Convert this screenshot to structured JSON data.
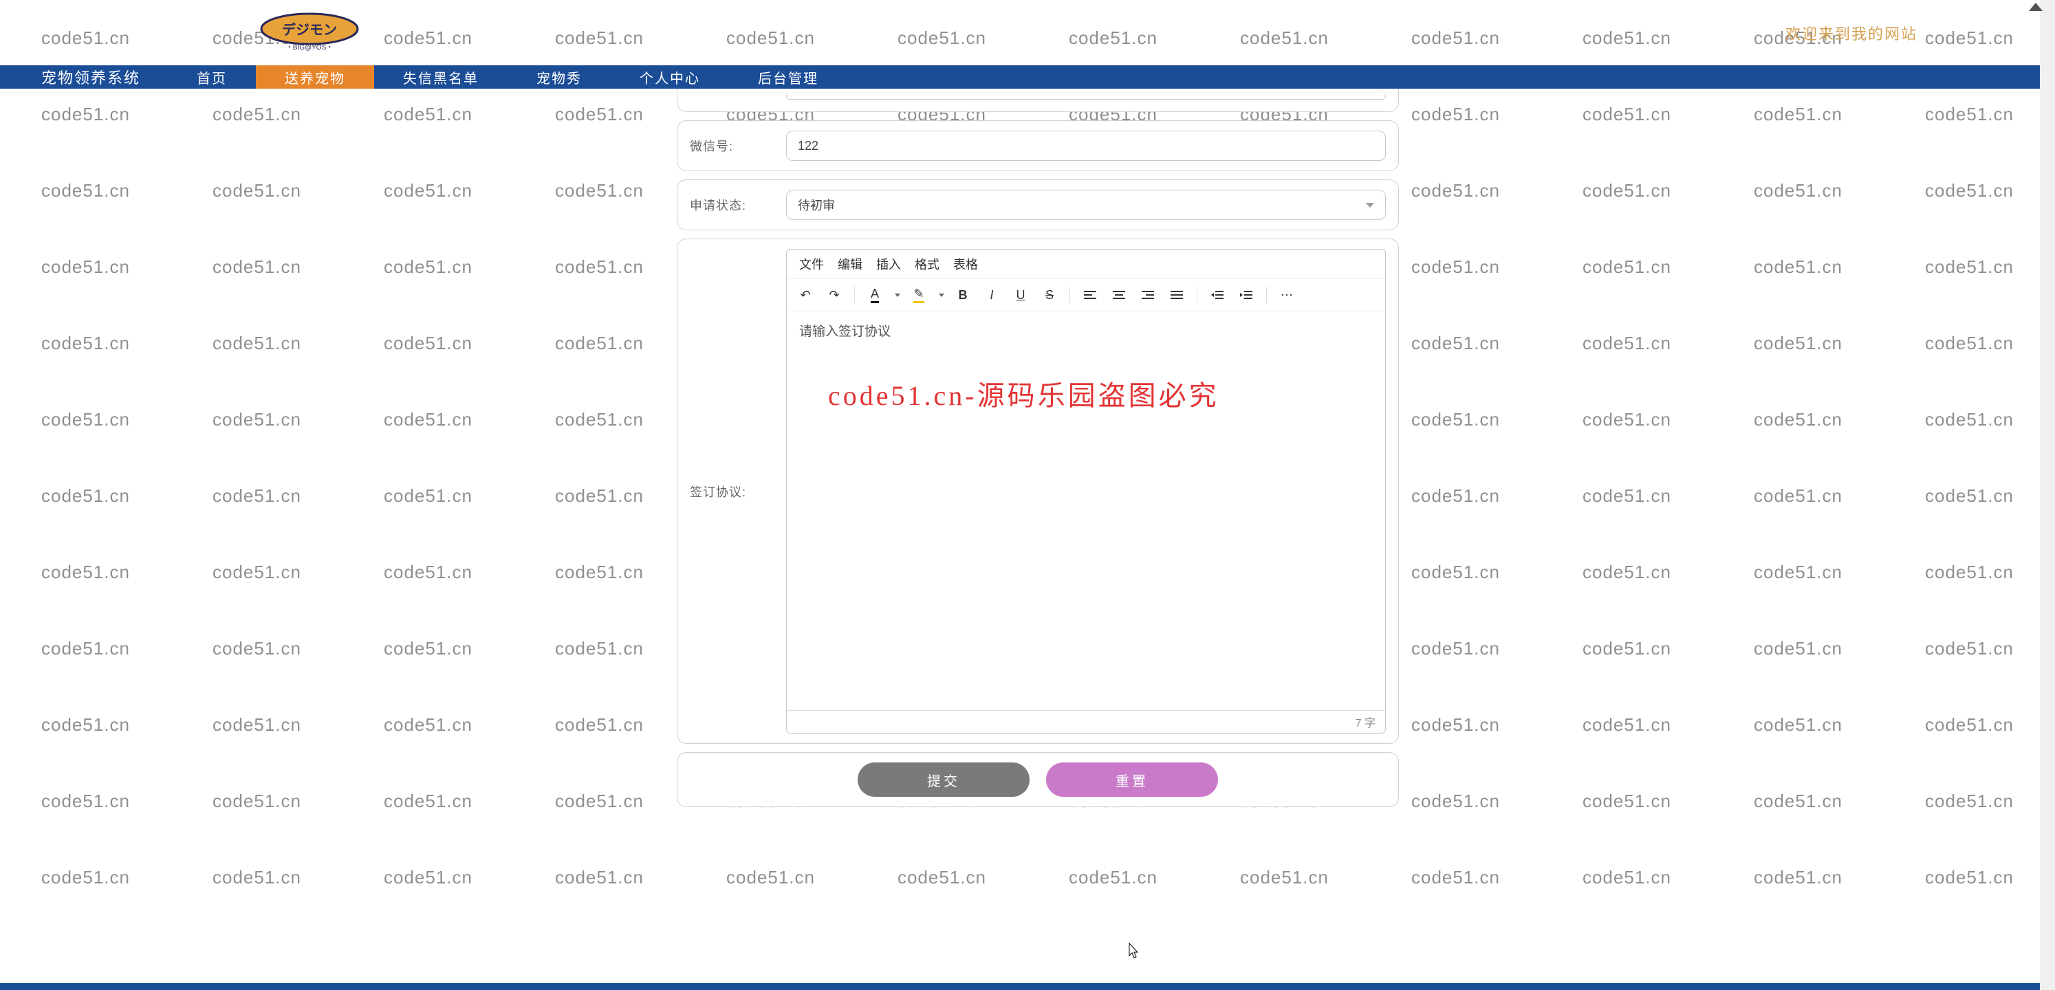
{
  "watermark": "code51.cn",
  "header": {
    "welcome": "欢迎来到我的网站",
    "logo_main": "デジモン",
    "logo_sub": "・BIG@YOS・"
  },
  "nav": {
    "title": "宠物领养系统",
    "items": [
      "首页",
      "送养宠物",
      "失信黑名单",
      "宠物秀",
      "个人中心",
      "后台管理"
    ],
    "active_index": 1
  },
  "form": {
    "wechat": {
      "label": "微信号:",
      "value": "122"
    },
    "status": {
      "label": "申请状态:",
      "value": "待初审"
    },
    "agreement": {
      "label": "签订协议:"
    }
  },
  "editor": {
    "menu": [
      "文件",
      "编辑",
      "插入",
      "格式",
      "表格"
    ],
    "placeholder": "请输入签订协议",
    "word_count": "7 字",
    "overlay_text": "code51.cn-源码乐园盗图必究"
  },
  "buttons": {
    "submit": "提交",
    "reset": "重置"
  }
}
